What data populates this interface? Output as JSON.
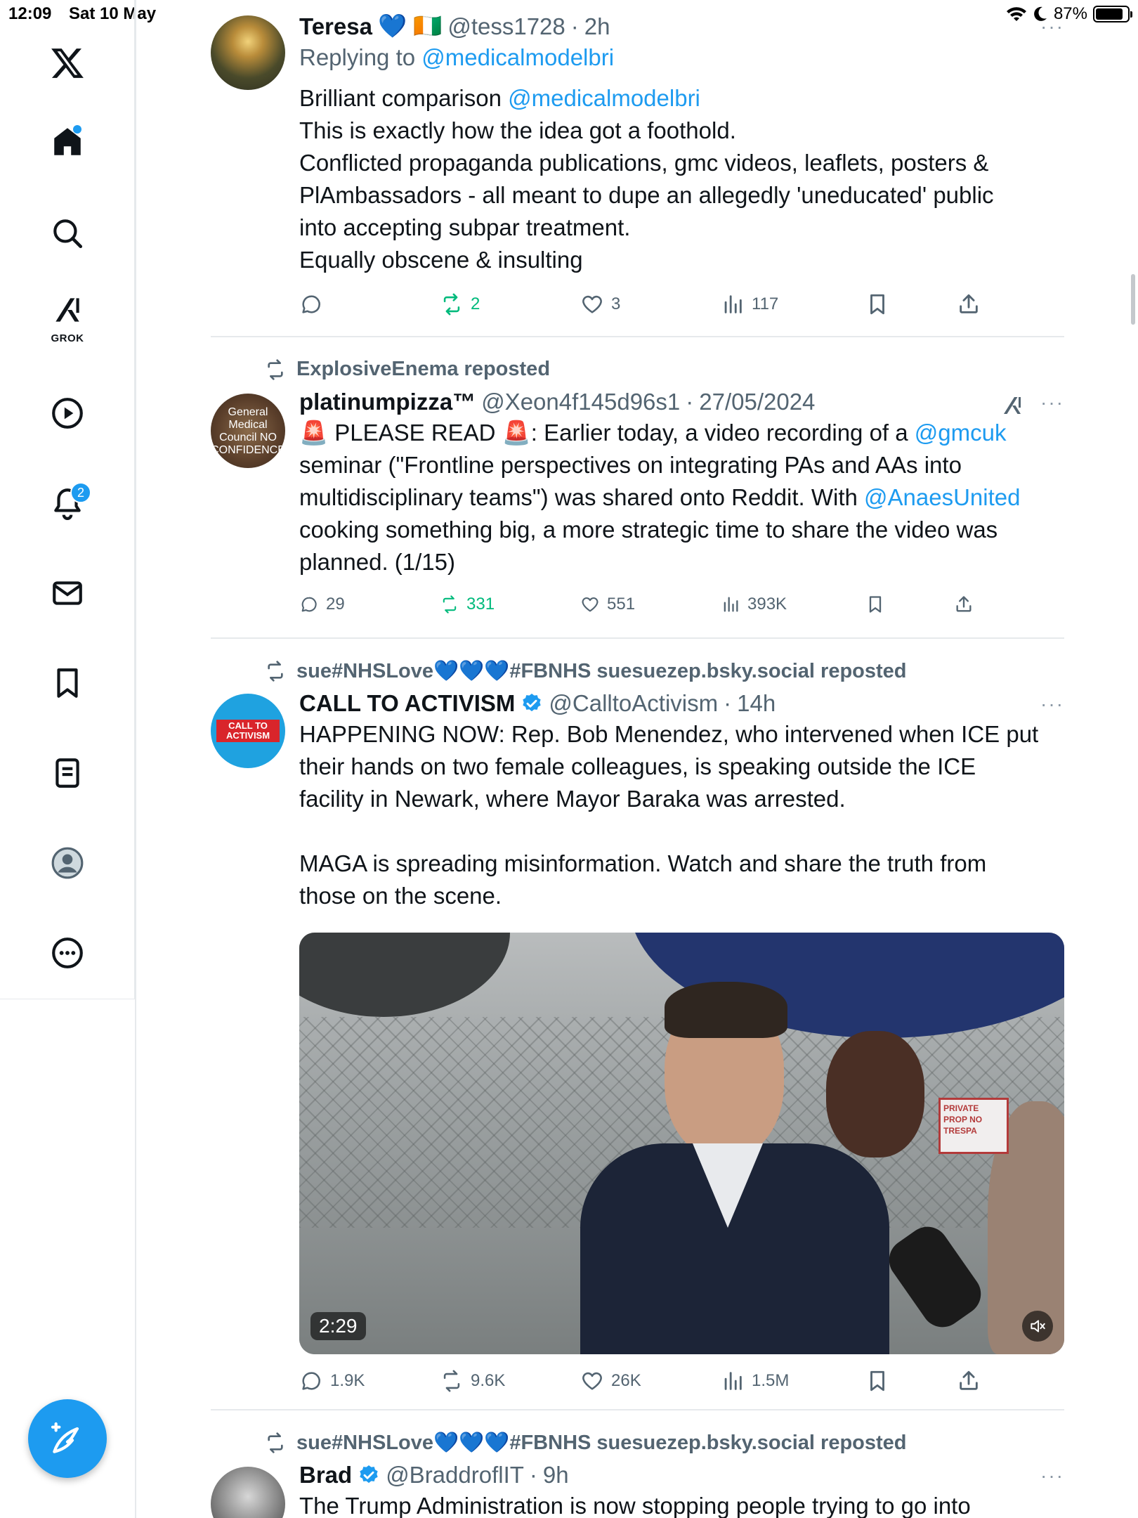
{
  "status_bar": {
    "time": "12:09",
    "date": "Sat 10 May",
    "battery": "87%",
    "battery_level": 0.87
  },
  "nav": {
    "notifications_count": "2",
    "grok_label": "GROK"
  },
  "tweets": [
    {
      "name": "Teresa",
      "flags": "💙 🇨🇮",
      "handle": "@tess1728",
      "time": "2h",
      "replying_prefix": "Replying to",
      "replying_to": "@medicalmodelbri",
      "lines": [
        {
          "pre": "Brilliant comparison ",
          "link": "@medicalmodelbri",
          "post": ""
        },
        {
          "pre": "This is exactly how the idea got a foothold.",
          "link": "",
          "post": ""
        },
        {
          "pre": "Conflicted propaganda publications, gmc videos, leaflets, posters &",
          "link": "",
          "post": ""
        },
        {
          "pre": "PlAmbassadors - all meant to dupe an allegedly 'uneducated' public",
          "link": "",
          "post": ""
        },
        {
          "pre": "into accepting subpar treatment.",
          "link": "",
          "post": ""
        },
        {
          "pre": "Equally obscene & insulting",
          "link": "",
          "post": ""
        }
      ],
      "stats": {
        "replies": "",
        "reposts": "2",
        "likes": "3",
        "views": "117"
      }
    },
    {
      "reposted_by": "ExplosiveEnema reposted",
      "name": "platinumpizza™",
      "handle": "@Xeon4f145d96s1",
      "time": "27/05/2024",
      "lines": [
        {
          "pre": "🚨 PLEASE READ 🚨: Earlier today, a video recording of a ",
          "link": "@gmcuk",
          "post": ""
        },
        {
          "pre": "seminar (\"Frontline perspectives on integrating PAs and AAs into",
          "link": "",
          "post": ""
        },
        {
          "pre": "multidisciplinary teams\") was shared onto Reddit. With ",
          "link": "@AnaesUnited",
          "post": ""
        },
        {
          "pre": "cooking something big, a more strategic time to share the video was",
          "link": "",
          "post": ""
        },
        {
          "pre": "planned. (1/15)",
          "link": "",
          "post": ""
        }
      ],
      "stats": {
        "replies": "29",
        "reposts": "331",
        "likes": "551",
        "views": "393K"
      }
    },
    {
      "reposted_by": "sue#NHSLove💙💙💙#FBNHS suesuezep.bsky.social reposted",
      "name": "CALL TO ACTIVISM",
      "handle": "@CalltoActivism",
      "time": "14h",
      "lines": [
        {
          "pre": "HAPPENING NOW: Rep. Bob Menendez, who intervened when ICE put",
          "link": "",
          "post": ""
        },
        {
          "pre": "their hands on two female colleagues, is speaking outside the ICE",
          "link": "",
          "post": ""
        },
        {
          "pre": "facility in Newark, where Mayor Baraka was arrested.",
          "link": "",
          "post": ""
        },
        {
          "pre": "",
          "link": "",
          "post": ""
        },
        {
          "pre": "MAGA is spreading misinformation. Watch and share the truth from",
          "link": "",
          "post": ""
        },
        {
          "pre": "those on the scene.",
          "link": "",
          "post": ""
        }
      ],
      "video_duration": "2:29",
      "avatar_text": "CALL TO ACTIVISM",
      "stats": {
        "replies": "1.9K",
        "reposts": "9.6K",
        "likes": "26K",
        "views": "1.5M"
      }
    },
    {
      "reposted_by": "sue#NHSLove💙💙💙#FBNHS suesuezep.bsky.social reposted",
      "name": "Brad",
      "handle": "@BraddroflIT",
      "time": "9h",
      "lines": [
        {
          "pre": "The Trump Administration is now stopping people trying to go into",
          "link": "",
          "post": ""
        }
      ]
    }
  ],
  "avatar2_text": "General Medical Council NO CONFIDENCE",
  "video_sign": "PRIVATE PROP NO TRESPA",
  "colors": {
    "accent": "#1d9bf0",
    "repost_green": "#00ba7c",
    "muted": "#536471"
  }
}
